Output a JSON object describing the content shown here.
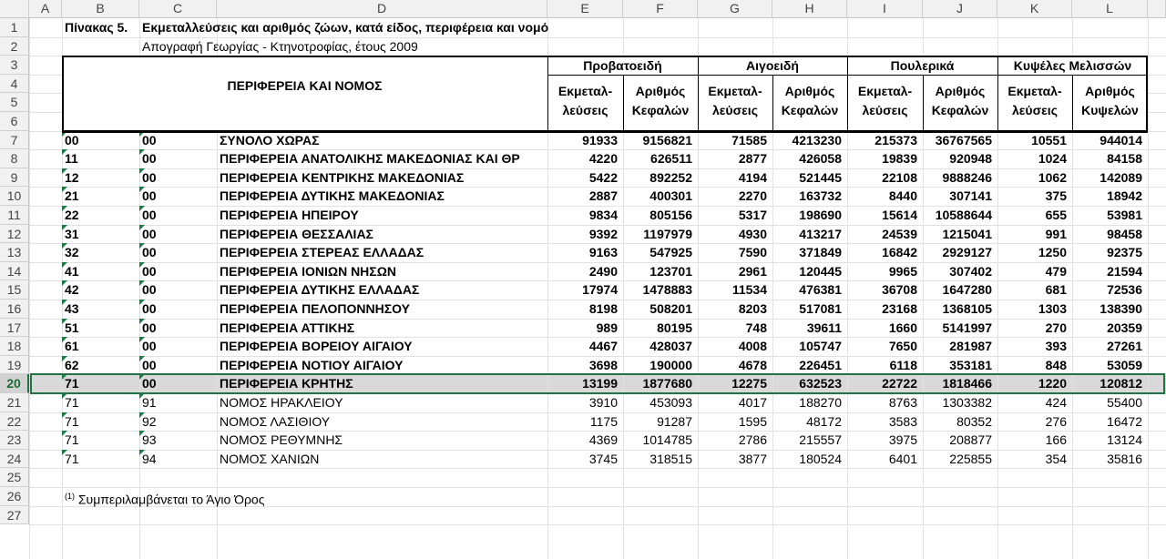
{
  "columns": [
    "A",
    "B",
    "C",
    "D",
    "E",
    "F",
    "G",
    "H",
    "I",
    "J",
    "K",
    "L"
  ],
  "rows": [
    "1",
    "2",
    "3",
    "4",
    "5",
    "6",
    "7",
    "8",
    "9",
    "10",
    "11",
    "12",
    "13",
    "14",
    "15",
    "16",
    "17",
    "18",
    "19",
    "20",
    "21",
    "22",
    "23",
    "24",
    "25",
    "26",
    "27"
  ],
  "title": "Πίνακας 5.  Εκμεταλλεύσεις και αριθμός ζώων, κατά είδος, περιφέρεια και νομό",
  "title_prefix": "Πίνακας 5.",
  "title_text": "Εκμεταλλεύσεις και αριθμός ζώων, κατά είδος, περιφέρεια και νομό",
  "subtitle": "Απογραφή Γεωργίας - Κτηνοτροφίας, έτους 2009",
  "header": {
    "region": "ΠΕΡΙΦΕΡΕΙΑ ΚΑΙ ΝΟΜΟΣ",
    "groups": [
      "Προβατοειδή",
      "Αιγοειδή",
      "Πουλερικά",
      "Κυψέλες Μελισσών"
    ],
    "sub": [
      [
        "Εκμεταλ-",
        "λεύσεις"
      ],
      [
        "Αριθμός",
        "Κεφαλών"
      ],
      [
        "Εκμεταλ-",
        "λεύσεις"
      ],
      [
        "Αριθμός",
        "Κεφαλών"
      ],
      [
        "Εκμεταλ-",
        "λεύσεις"
      ],
      [
        "Αριθμός",
        "Κεφαλών"
      ],
      [
        "Εκμεταλ-",
        "λεύσεις"
      ],
      [
        "Αριθμός",
        "Κυψελών"
      ]
    ]
  },
  "data": [
    {
      "b": "00",
      "c": "00",
      "d": "ΣΥΝΟΛΟ ΧΩΡΑΣ",
      "v": [
        "91933",
        "9156821",
        "71585",
        "4213230",
        "215373",
        "36767565",
        "10551",
        "944014"
      ],
      "bold": true
    },
    {
      "b": "11",
      "c": "00",
      "d": "ΠΕΡΙΦΕΡΕΙΑ ΑΝΑΤΟΛΙΚΗΣ ΜΑΚΕΔΟΝΙΑΣ ΚΑΙ ΘΡ",
      "v": [
        "4220",
        "626511",
        "2877",
        "426058",
        "19839",
        "920948",
        "1024",
        "84158"
      ],
      "bold": true
    },
    {
      "b": "12",
      "c": "00",
      "d": "ΠΕΡΙΦΕΡΕΙΑ ΚΕΝΤΡΙΚΗΣ ΜΑΚΕΔΟΝΙΑΣ",
      "v": [
        "5422",
        "892252",
        "4194",
        "521445",
        "22108",
        "9888246",
        "1062",
        "142089"
      ],
      "bold": true
    },
    {
      "b": "21",
      "c": "00",
      "d": "ΠΕΡΙΦΕΡΕΙΑ ΔΥΤΙΚΗΣ ΜΑΚΕΔΟΝΙΑΣ",
      "v": [
        "2887",
        "400301",
        "2270",
        "163732",
        "8440",
        "307141",
        "375",
        "18942"
      ],
      "bold": true
    },
    {
      "b": "22",
      "c": "00",
      "d": "ΠΕΡΙΦΕΡΕΙΑ ΗΠΕΙΡΟΥ",
      "v": [
        "9834",
        "805156",
        "5317",
        "198690",
        "15614",
        "10588644",
        "655",
        "53981"
      ],
      "bold": true
    },
    {
      "b": "31",
      "c": "00",
      "d": "ΠΕΡΙΦΕΡΕΙΑ ΘΕΣΣΑΛΙΑΣ",
      "v": [
        "9392",
        "1197979",
        "4930",
        "413217",
        "24539",
        "1215041",
        "991",
        "98458"
      ],
      "bold": true
    },
    {
      "b": "32",
      "c": "00",
      "d": "ΠΕΡΙΦΕΡΕΙΑ ΣΤΕΡΕΑΣ ΕΛΛΑΔΑΣ",
      "v": [
        "9163",
        "547925",
        "7590",
        "371849",
        "16842",
        "2929127",
        "1250",
        "92375"
      ],
      "bold": true
    },
    {
      "b": "41",
      "c": "00",
      "d": "ΠΕΡΙΦΕΡΕΙΑ ΙΟΝΙΩΝ ΝΗΣΩΝ",
      "v": [
        "2490",
        "123701",
        "2961",
        "120445",
        "9965",
        "307402",
        "479",
        "21594"
      ],
      "bold": true
    },
    {
      "b": "42",
      "c": "00",
      "d": "ΠΕΡΙΦΕΡΕΙΑ ΔΥΤΙΚΗΣ ΕΛΛΑΔΑΣ",
      "v": [
        "17974",
        "1478883",
        "11534",
        "476381",
        "36708",
        "1647280",
        "681",
        "72536"
      ],
      "bold": true
    },
    {
      "b": "43",
      "c": "00",
      "d": "ΠΕΡΙΦΕΡΕΙΑ ΠΕΛΟΠΟΝΝΗΣΟΥ",
      "v": [
        "8198",
        "508201",
        "8203",
        "517081",
        "23168",
        "1368105",
        "1303",
        "138390"
      ],
      "bold": true
    },
    {
      "b": "51",
      "c": "00",
      "d": "ΠΕΡΙΦΕΡΕΙΑ ΑΤΤΙΚΗΣ",
      "v": [
        "989",
        "80195",
        "748",
        "39611",
        "1660",
        "5141997",
        "270",
        "20359"
      ],
      "bold": true
    },
    {
      "b": "61",
      "c": "00",
      "d": "ΠΕΡΙΦΕΡΕΙΑ ΒΟΡΕΙΟΥ ΑΙΓΑΙΟΥ",
      "v": [
        "4467",
        "428037",
        "4008",
        "105747",
        "7650",
        "281987",
        "393",
        "27261"
      ],
      "bold": true
    },
    {
      "b": "62",
      "c": "00",
      "d": "ΠΕΡΙΦΕΡΕΙΑ ΝΟΤΙΟΥ ΑΙΓΑΙΟΥ",
      "v": [
        "3698",
        "190000",
        "4678",
        "226451",
        "6118",
        "353181",
        "848",
        "53059"
      ],
      "bold": true
    },
    {
      "b": "71",
      "c": "00",
      "d": "ΠΕΡΙΦΕΡΕΙΑ ΚΡΗΤΗΣ",
      "v": [
        "13199",
        "1877680",
        "12275",
        "632523",
        "22722",
        "1818466",
        "1220",
        "120812"
      ],
      "bold": true
    },
    {
      "b": "71",
      "c": "91",
      "d": "ΝΟΜΟΣ ΗΡΑΚΛΕΙΟΥ",
      "v": [
        "3910",
        "453093",
        "4017",
        "188270",
        "8763",
        "1303382",
        "424",
        "55400"
      ],
      "bold": false
    },
    {
      "b": "71",
      "c": "92",
      "d": "ΝΟΜΟΣ ΛΑΣΙΘΙΟΥ",
      "v": [
        "1175",
        "91287",
        "1595",
        "48172",
        "3583",
        "80352",
        "276",
        "16472"
      ],
      "bold": false
    },
    {
      "b": "71",
      "c": "93",
      "d": "ΝΟΜΟΣ ΡΕΘΥΜΝΗΣ",
      "v": [
        "4369",
        "1014785",
        "2786",
        "215557",
        "3975",
        "208877",
        "166",
        "13124"
      ],
      "bold": false
    },
    {
      "b": "71",
      "c": "94",
      "d": "ΝΟΜΟΣ ΧΑΝΙΩΝ",
      "v": [
        "3745",
        "318515",
        "3877",
        "180524",
        "6401",
        "225855",
        "354",
        "35816"
      ],
      "bold": false
    }
  ],
  "footnote_mark": "(1)",
  "footnote": " Συμπεριλαμβάνεται το Άγιο Όρος",
  "selected_row": "20",
  "accent_color": "#217346"
}
